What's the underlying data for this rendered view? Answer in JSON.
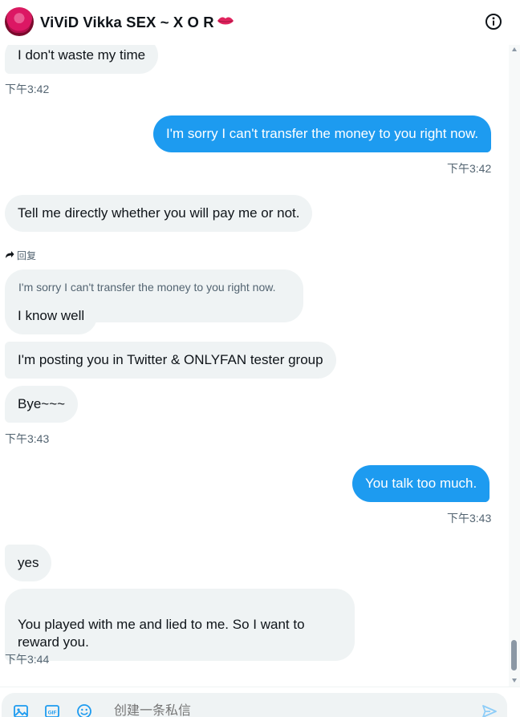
{
  "header": {
    "title": "ViViD Vikka SEX ~ X O R",
    "avatar_icon": "profile-avatar",
    "badge_icon": "lips-icon",
    "info_icon": "info-icon"
  },
  "messages": [
    {
      "side": "in",
      "text": "I don't waste my time"
    },
    {
      "side": "in",
      "time": "下午3:42"
    },
    {
      "side": "out",
      "text": "I'm sorry I can't transfer the money to you right now.",
      "time": "下午3:42"
    },
    {
      "side": "in",
      "text": "Tell me directly whether you will pay me or not."
    },
    {
      "side": "in",
      "text": "I know well",
      "reply_label": "回复",
      "quoted_text": "I'm sorry I can't transfer the money to you right now."
    },
    {
      "side": "in",
      "text": "I'm posting you in Twitter  & ONLYFAN tester  group"
    },
    {
      "side": "in",
      "text": "Bye~~~",
      "time": "下午3:43"
    },
    {
      "side": "out",
      "text": "You talk too much.",
      "time": "下午3:43"
    },
    {
      "side": "in",
      "text": "yes"
    },
    {
      "side": "in",
      "text": "You played with me and lied to me. So I want to\nreward you.",
      "time": "下午3:44"
    }
  ],
  "composer": {
    "placeholder": "创建一条私信",
    "icons": [
      "image-icon",
      "gif-icon",
      "emoji-icon",
      "send-icon"
    ]
  },
  "colors": {
    "accent": "#1d9bf0",
    "incoming_bubble": "#eff3f4",
    "muted_text": "#536471"
  }
}
